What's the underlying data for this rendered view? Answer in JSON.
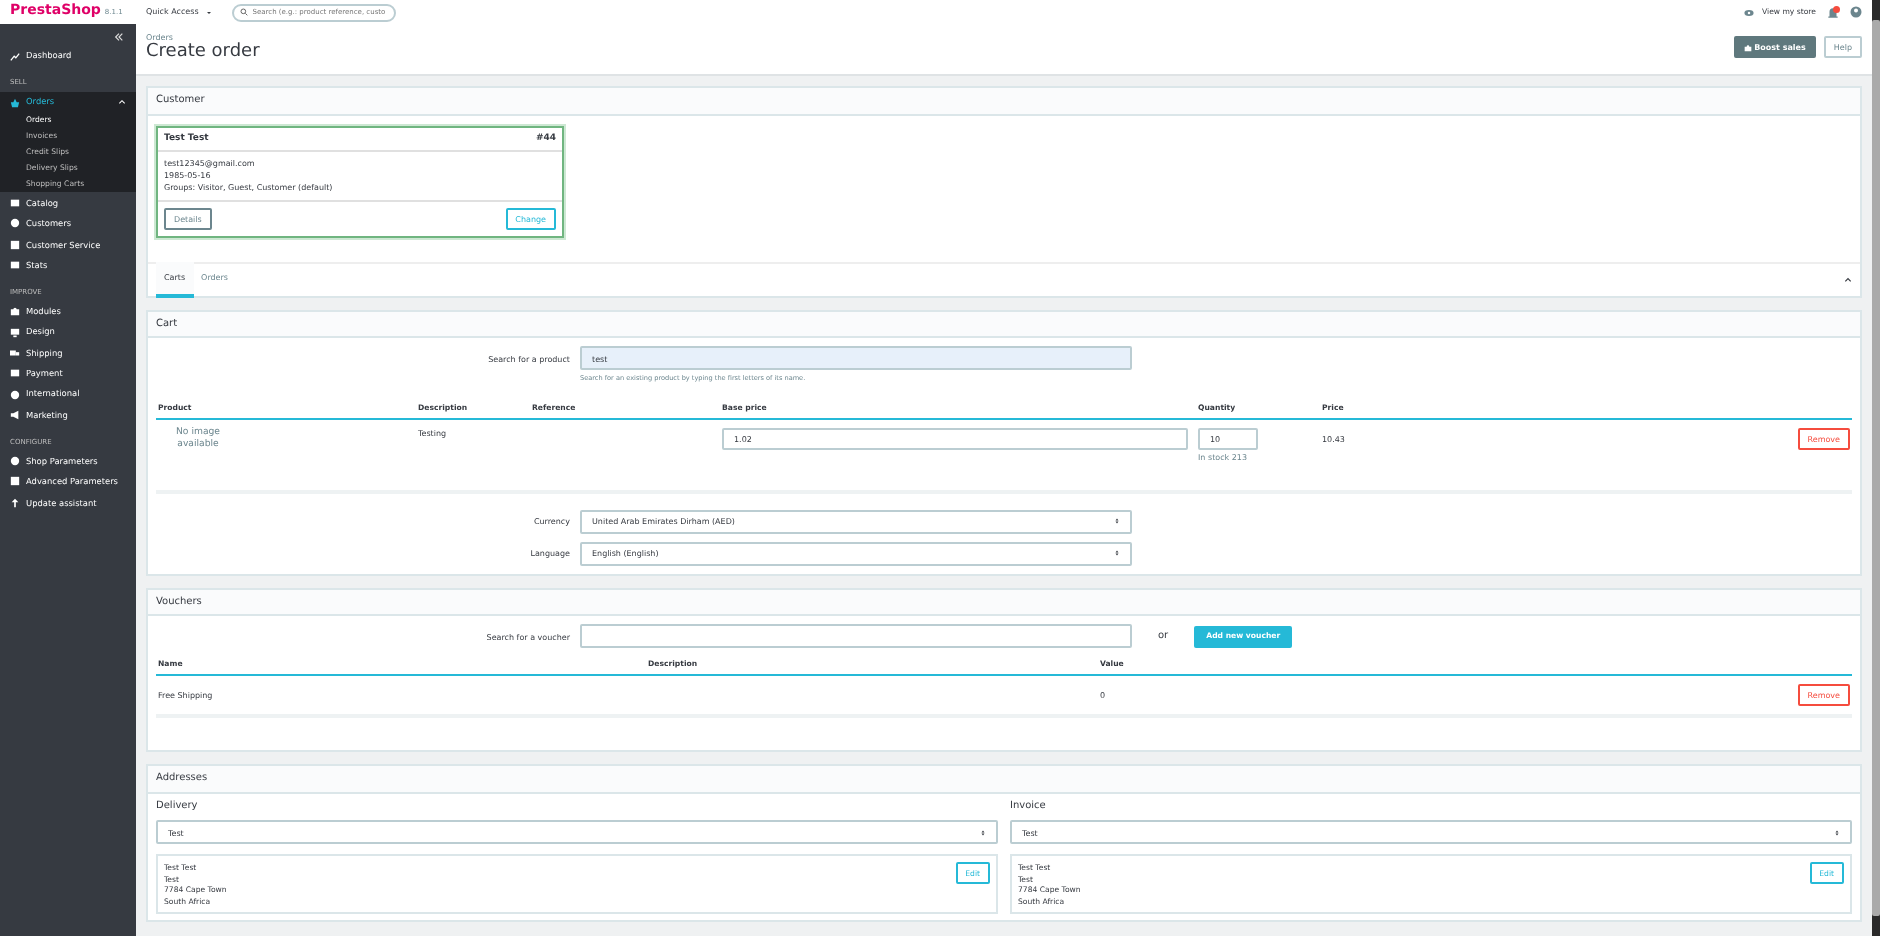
{
  "brand": {
    "name": "PrestaShop",
    "version": "8.1.1"
  },
  "topbar": {
    "quick_access": "Quick Access",
    "search_placeholder": "Search (e.g.: product reference, custo",
    "view_store": "View my store"
  },
  "sidebar": [
    {
      "kind": "link",
      "label": "Dashboard",
      "selected": false
    },
    {
      "kind": "heading",
      "label": "SELL"
    },
    {
      "kind": "link",
      "label": "Orders",
      "selected": true,
      "expanded": true,
      "children": [
        {
          "label": "Orders",
          "selected": true
        },
        {
          "label": "Invoices",
          "selected": false
        },
        {
          "label": "Credit Slips",
          "selected": false
        },
        {
          "label": "Delivery Slips",
          "selected": false
        },
        {
          "label": "Shopping Carts",
          "selected": false
        }
      ]
    },
    {
      "kind": "link",
      "label": "Catalog",
      "selected": false
    },
    {
      "kind": "link",
      "label": "Customers",
      "selected": false
    },
    {
      "kind": "link",
      "label": "Customer Service",
      "selected": false
    },
    {
      "kind": "link",
      "label": "Stats",
      "selected": false
    },
    {
      "kind": "heading",
      "label": "IMPROVE"
    },
    {
      "kind": "link",
      "label": "Modules",
      "selected": false
    },
    {
      "kind": "link",
      "label": "Design",
      "selected": false
    },
    {
      "kind": "link",
      "label": "Shipping",
      "selected": false
    },
    {
      "kind": "link",
      "label": "Payment",
      "selected": false
    },
    {
      "kind": "link",
      "label": "International",
      "selected": false
    },
    {
      "kind": "link",
      "label": "Marketing",
      "selected": false
    },
    {
      "kind": "heading",
      "label": "CONFIGURE"
    },
    {
      "kind": "link",
      "label": "Shop Parameters",
      "selected": false
    },
    {
      "kind": "link",
      "label": "Advanced Parameters",
      "selected": false
    },
    {
      "kind": "link",
      "label": "Update assistant",
      "selected": false
    }
  ],
  "breadcrumb": "Orders",
  "page_title": "Create order",
  "header_buttons": [
    {
      "label": "Boost sales",
      "kind": "primary"
    },
    {
      "label": "Help",
      "kind": "outline"
    }
  ],
  "customer": {
    "heading": "Customer",
    "card": {
      "name": "Test Test",
      "id": "#44",
      "lines": [
        "test12345@gmail.com",
        "1985-05-16",
        "Groups: Visitor, Guest, Customer (default)"
      ],
      "buttons": [
        {
          "label": "Details",
          "kind": "secondary"
        },
        {
          "label": "Change",
          "kind": "info"
        }
      ]
    },
    "tabs": [
      {
        "label": "Carts",
        "selected": true
      },
      {
        "label": "Orders",
        "selected": false
      }
    ]
  },
  "cart": {
    "heading": "Cart",
    "search_label": "Search for a product",
    "search_value": "test",
    "search_help": "Search for an existing product by typing the first letters of its name.",
    "columns": [
      "Product",
      "Description",
      "Reference",
      "Base price",
      "Quantity",
      "Price"
    ],
    "rows": [
      {
        "product": "No image available",
        "description": "Testing",
        "base_price": "1.02",
        "quantity": "10",
        "stock": "In stock 213",
        "price": "10.43",
        "action": "Remove"
      }
    ],
    "currency_label": "Currency",
    "currency": "United Arab Emirates Dirham (AED)",
    "language_label": "Language",
    "language": "English (English)"
  },
  "vouchers": {
    "heading": "Vouchers",
    "search_label": "Search for a voucher",
    "or": "or",
    "add_button": "Add new voucher",
    "columns": [
      "Name",
      "Description",
      "Value"
    ],
    "rows": [
      {
        "name": "Free Shipping",
        "value": "0",
        "action": "Remove"
      }
    ]
  },
  "addresses": {
    "heading": "Addresses",
    "columns": [
      {
        "label": "Delivery",
        "value": "Test",
        "lines": [
          "Test Test",
          "Test",
          "7784 Cape Town",
          "South Africa"
        ],
        "edit": "Edit"
      },
      {
        "label": "Invoice",
        "value": "Test",
        "lines": [
          "Test Test",
          "Test",
          "7784 Cape Town",
          "South Africa"
        ],
        "edit": "Edit"
      }
    ]
  }
}
